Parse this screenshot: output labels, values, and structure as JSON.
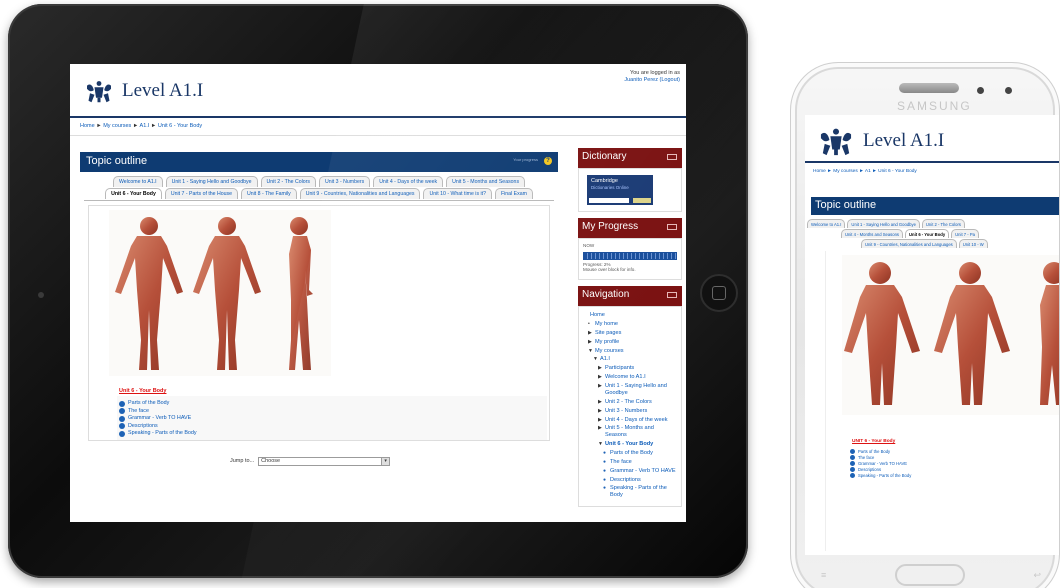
{
  "site": {
    "title": "Level A1.I"
  },
  "login": {
    "text": "You are logged in as",
    "user_link": "Juanito Perez (Logout)"
  },
  "breadcrumb": {
    "home": "Home",
    "sep": "►",
    "courses": "My courses",
    "course": "A1.I",
    "current": "Unit 6 - Your Body"
  },
  "topic": {
    "title": "Topic outline",
    "hint": "Your progress"
  },
  "tabs": {
    "row1": [
      "Welcome to A1.I",
      "Unit 1 - Saying Hello and Goodbye",
      "Unit 2 - The Colors",
      "Unit 3 - Numbers",
      "Unit 4 - Days of the week",
      "Unit 5 - Months and Seasons"
    ],
    "row2": [
      "Unit 6 - Your Body",
      "Unit 7 - Parts of the House",
      "Unit 8 - The Family",
      "Unit 9 - Countries, Nationalities and Languages",
      "Unit 10 - What time is it?",
      "Final Exam"
    ],
    "active": "Unit 6 - Your Body"
  },
  "section": {
    "title": "Unit 6 - Your Body",
    "activities": [
      "Parts of the Body",
      "The face",
      "Grammar - Verb TO HAVE",
      "Descriptions",
      "Speaking - Parts of the Body"
    ]
  },
  "jump": {
    "label": "Jump to...",
    "selected": "Choose"
  },
  "dictionary": {
    "title": "Dictionary",
    "logo_main": "Cambridge",
    "logo_sub": "Dictionaries Online"
  },
  "progress": {
    "title": "My Progress",
    "label": "NOW",
    "percent_text": "Progress: 2%",
    "hover_hint": "Mouse over block for info."
  },
  "navigation": {
    "title": "Navigation",
    "items": [
      {
        "label": "Home",
        "level": 0,
        "marker": ""
      },
      {
        "label": "My home",
        "level": 1,
        "marker": "•"
      },
      {
        "label": "Site pages",
        "level": 1,
        "marker": "▶"
      },
      {
        "label": "My profile",
        "level": 1,
        "marker": "▶"
      },
      {
        "label": "My courses",
        "level": 1,
        "marker": "▼"
      },
      {
        "label": "A1.I",
        "level": 2,
        "marker": "▼"
      },
      {
        "label": "Participants",
        "level": 3,
        "marker": "▶"
      },
      {
        "label": "Welcome to A1.I",
        "level": 3,
        "marker": "▶"
      },
      {
        "label": "Unit 1 - Saying Hello and Goodbye",
        "level": 3,
        "marker": "▶"
      },
      {
        "label": "Unit 2 - The Colors",
        "level": 3,
        "marker": "▶"
      },
      {
        "label": "Unit 3 - Numbers",
        "level": 3,
        "marker": "▶"
      },
      {
        "label": "Unit 4 - Days of the week",
        "level": 3,
        "marker": "▶"
      },
      {
        "label": "Unit 5 - Months and Seasons",
        "level": 3,
        "marker": "▶"
      },
      {
        "label": "Unit 6 - Your Body",
        "level": 3,
        "marker": "▼"
      },
      {
        "label": "Parts of the Body",
        "level": 4,
        "marker": "●"
      },
      {
        "label": "The face",
        "level": 4,
        "marker": "●"
      },
      {
        "label": "Grammar - Verb TO HAVE",
        "level": 4,
        "marker": "●"
      },
      {
        "label": "Descriptions",
        "level": 4,
        "marker": "●"
      },
      {
        "label": "Speaking - Parts of the Body",
        "level": 4,
        "marker": "●"
      }
    ]
  },
  "phone": {
    "brand": "SAMSUNG",
    "breadcrumb": "Home ► My courses ► A1 ► Unit 6 - Your Body",
    "tabs": {
      "row1": [
        "Welcome to A1.I",
        "Unit 1 - Saying Hello and Goodbye",
        "Unit 2 - The Colors"
      ],
      "row2": [
        "Unit 4 - Months and Seasons",
        "Unit 6 - Your Body",
        "Unit 7 - Pa"
      ],
      "row3": [
        "Unit 9 - Countries, Nationalities and Languages",
        "Unit 10 - W"
      ]
    },
    "section_title": "UNIT 6 - Your Body",
    "activities": [
      "Parts of the Body",
      "The face",
      "Grammar - Verb TO HAVE",
      "Descriptions",
      "Speaking - Parts of the Body"
    ]
  },
  "icons": [
    "crest-icon",
    "help-icon",
    "block-control-icon",
    "activity-icon",
    "dropdown-caret-icon"
  ]
}
